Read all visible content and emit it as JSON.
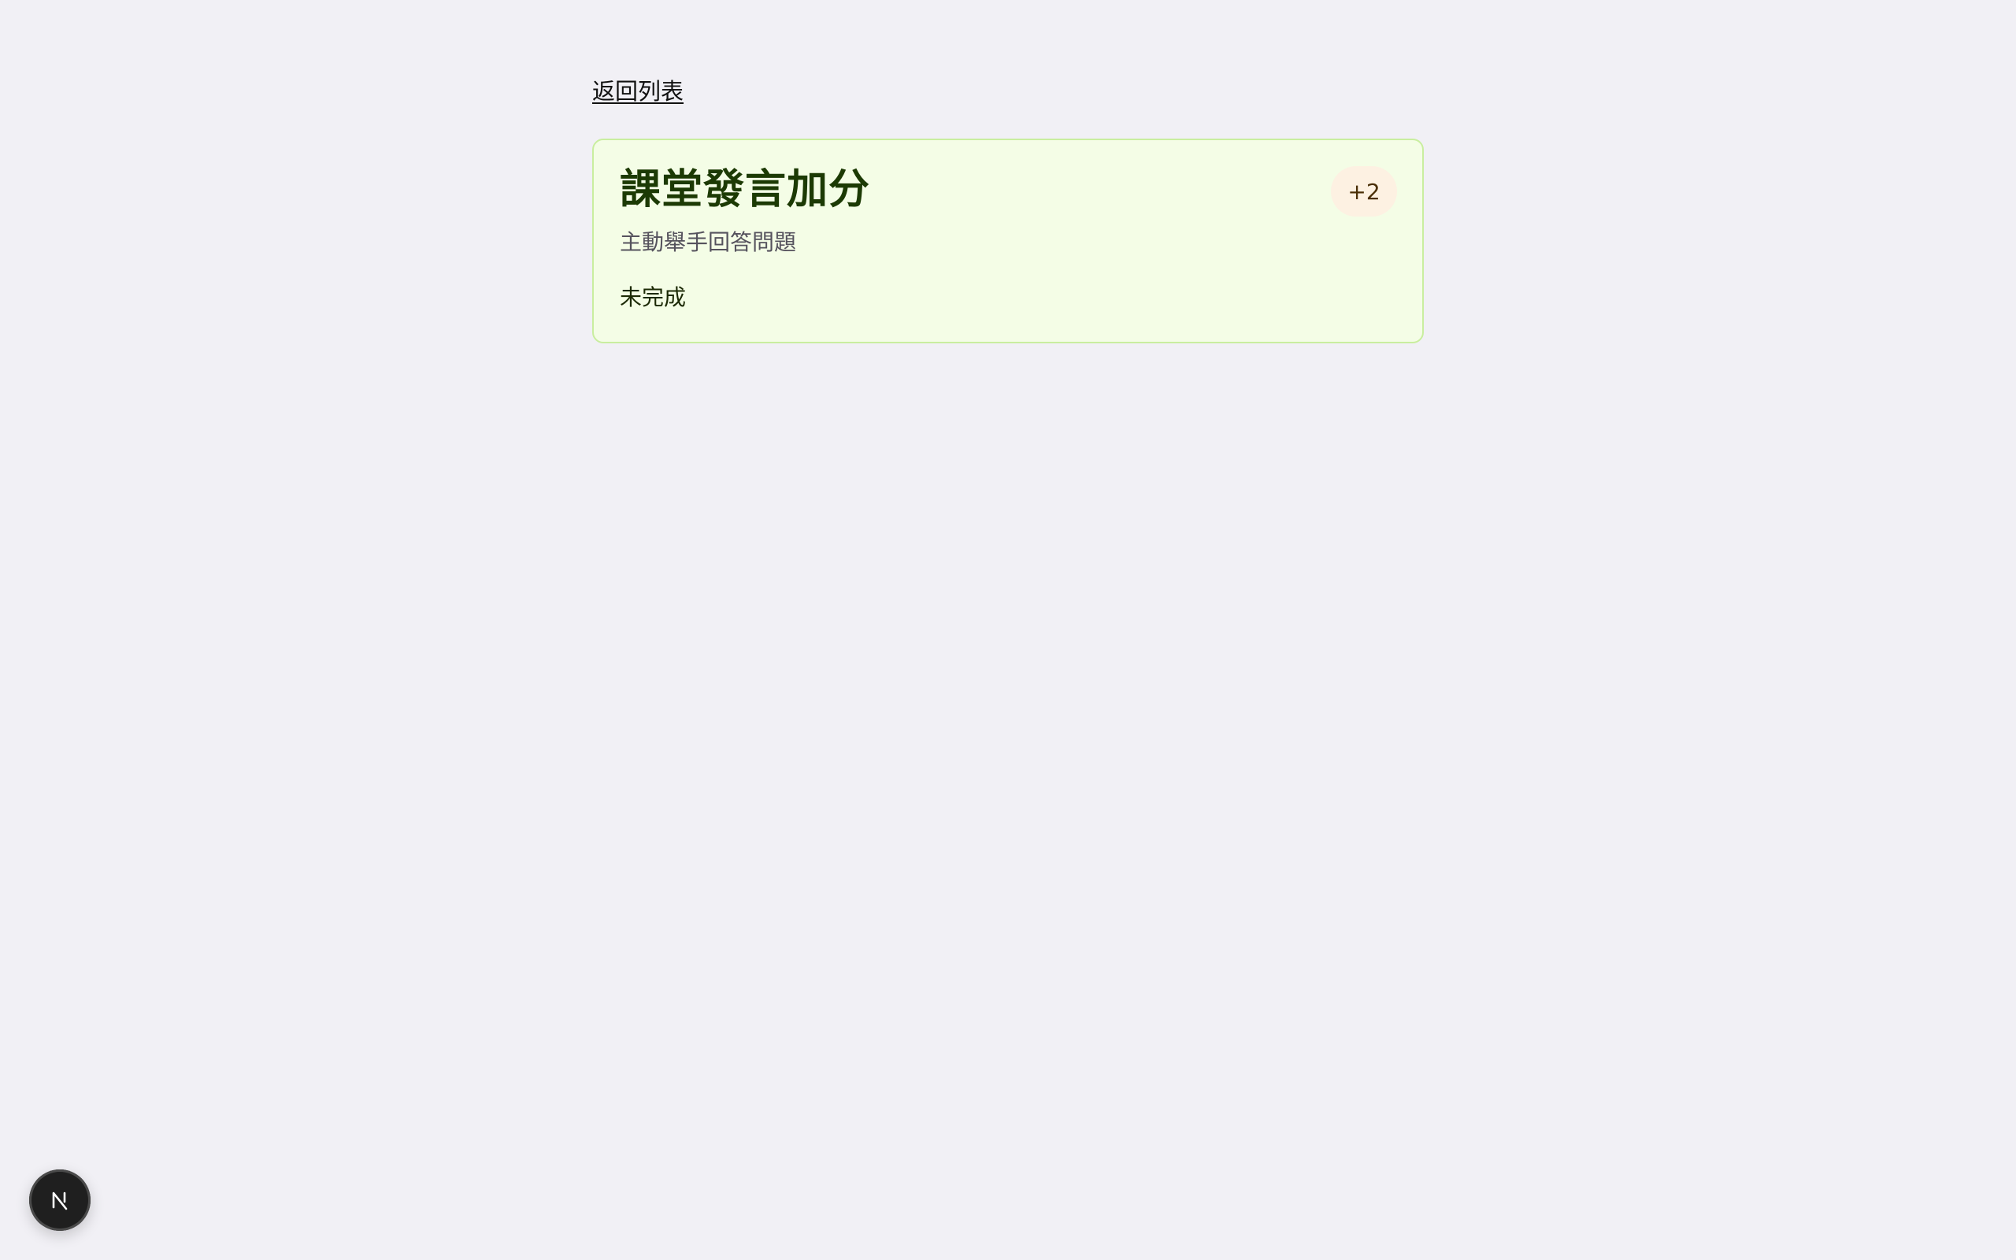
{
  "nav": {
    "back_label": "返回列表"
  },
  "task": {
    "title": "課堂發言加分",
    "description": "主動舉手回答問題",
    "status": "未完成",
    "points": "+2"
  },
  "dev_indicator": {
    "icon": "nextjs-logo-icon"
  },
  "colors": {
    "background": "#f1f0f5",
    "card_background": "#f4fde6",
    "card_border": "#c9ee9f",
    "title": "#1c3a04",
    "badge_background": "#fdf1e2"
  }
}
